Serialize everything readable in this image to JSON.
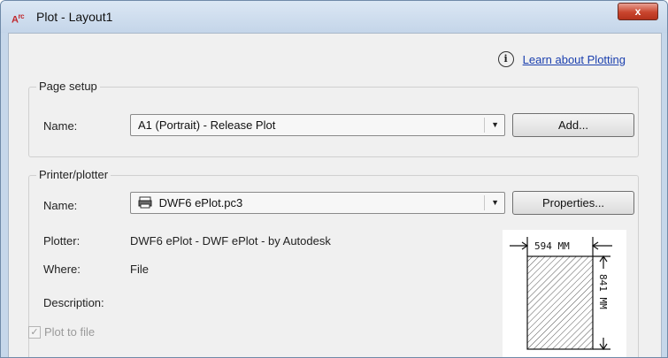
{
  "window": {
    "app_icon": "A",
    "app_icon_sub": "rc",
    "title": "Plot - Layout1",
    "close_label": "x"
  },
  "help": {
    "icon": "info-icon",
    "info_glyph": "i",
    "link_label": "Learn about Plotting"
  },
  "page_setup": {
    "legend": "Page setup",
    "name_label": "Name:",
    "name_value": "A1 (Portrait) - Release Plot",
    "add_button": "Add..."
  },
  "printer": {
    "legend": "Printer/plotter",
    "name_label": "Name:",
    "name_value": "DWF6 ePlot.pc3",
    "properties_button": "Properties...",
    "plotter_label": "Plotter:",
    "plotter_value": "DWF6 ePlot - DWF ePlot - by Autodesk",
    "where_label": "Where:",
    "where_value": "File",
    "description_label": "Description:",
    "plot_to_file_label": "Plot to file",
    "plot_to_file_checked": true,
    "plot_to_file_enabled": false
  },
  "paper_preview": {
    "width_label": "594 MM",
    "height_label": "841 MM"
  },
  "colors": {
    "link": "#1a3fae",
    "close_button": "#c9452e",
    "window_frame": "#c6d7ea"
  }
}
